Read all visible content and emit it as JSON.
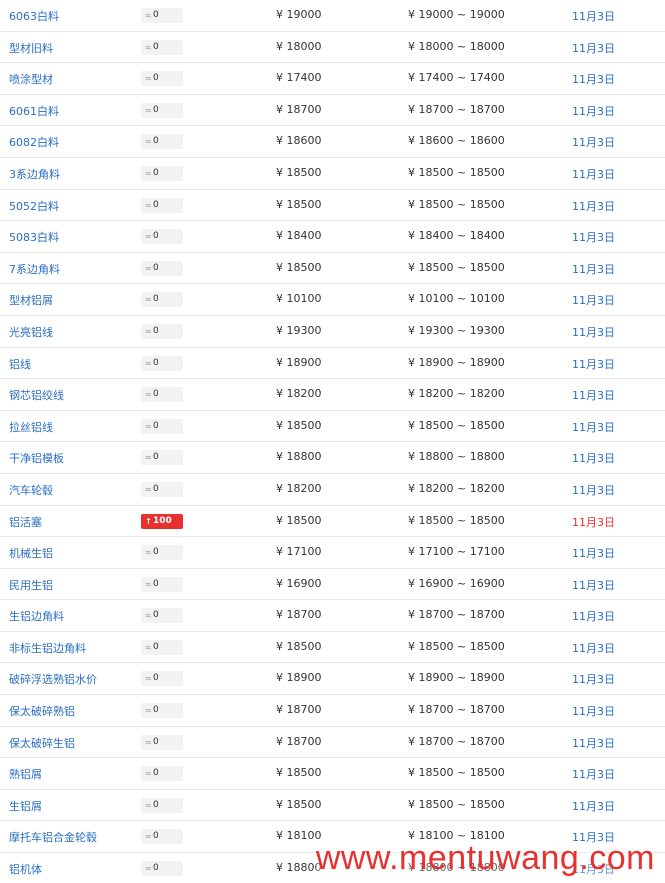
{
  "currency_symbol": "¥",
  "accent_color": "#2b6fc2",
  "up_color": "#e8302f",
  "watermark": "www.mentuwang.com",
  "rows": [
    {
      "name": "6063白料",
      "change": "0",
      "price": "¥ 19000",
      "range": "¥ 19000 ~ 19000",
      "date": "11月3日",
      "up": false
    },
    {
      "name": "型材旧料",
      "change": "0",
      "price": "¥ 18000",
      "range": "¥ 18000 ~ 18000",
      "date": "11月3日",
      "up": false
    },
    {
      "name": "喷涂型材",
      "change": "0",
      "price": "¥ 17400",
      "range": "¥ 17400 ~ 17400",
      "date": "11月3日",
      "up": false
    },
    {
      "name": "6061白料",
      "change": "0",
      "price": "¥ 18700",
      "range": "¥ 18700 ~ 18700",
      "date": "11月3日",
      "up": false
    },
    {
      "name": "6082白料",
      "change": "0",
      "price": "¥ 18600",
      "range": "¥ 18600 ~ 18600",
      "date": "11月3日",
      "up": false
    },
    {
      "name": "3系边角料",
      "change": "0",
      "price": "¥ 18500",
      "range": "¥ 18500 ~ 18500",
      "date": "11月3日",
      "up": false
    },
    {
      "name": "5052白料",
      "change": "0",
      "price": "¥ 18500",
      "range": "¥ 18500 ~ 18500",
      "date": "11月3日",
      "up": false
    },
    {
      "name": "5083白料",
      "change": "0",
      "price": "¥ 18400",
      "range": "¥ 18400 ~ 18400",
      "date": "11月3日",
      "up": false
    },
    {
      "name": "7系边角料",
      "change": "0",
      "price": "¥ 18500",
      "range": "¥ 18500 ~ 18500",
      "date": "11月3日",
      "up": false
    },
    {
      "name": "型材铝屑",
      "change": "0",
      "price": "¥ 10100",
      "range": "¥ 10100 ~ 10100",
      "date": "11月3日",
      "up": false
    },
    {
      "name": "光亮铝线",
      "change": "0",
      "price": "¥ 19300",
      "range": "¥ 19300 ~ 19300",
      "date": "11月3日",
      "up": false
    },
    {
      "name": "铝线",
      "change": "0",
      "price": "¥ 18900",
      "range": "¥ 18900 ~ 18900",
      "date": "11月3日",
      "up": false
    },
    {
      "name": "钢芯铝绞线",
      "change": "0",
      "price": "¥ 18200",
      "range": "¥ 18200 ~ 18200",
      "date": "11月3日",
      "up": false
    },
    {
      "name": "拉丝铝线",
      "change": "0",
      "price": "¥ 18500",
      "range": "¥ 18500 ~ 18500",
      "date": "11月3日",
      "up": false
    },
    {
      "name": "干净铝模板",
      "change": "0",
      "price": "¥ 18800",
      "range": "¥ 18800 ~ 18800",
      "date": "11月3日",
      "up": false
    },
    {
      "name": "汽车轮毂",
      "change": "0",
      "price": "¥ 18200",
      "range": "¥ 18200 ~ 18200",
      "date": "11月3日",
      "up": false
    },
    {
      "name": "铝活塞",
      "change": "100",
      "price": "¥ 18500",
      "range": "¥ 18500 ~ 18500",
      "date": "11月3日",
      "up": true
    },
    {
      "name": "机械生铝",
      "change": "0",
      "price": "¥ 17100",
      "range": "¥ 17100 ~ 17100",
      "date": "11月3日",
      "up": false
    },
    {
      "name": "民用生铝",
      "change": "0",
      "price": "¥ 16900",
      "range": "¥ 16900 ~ 16900",
      "date": "11月3日",
      "up": false
    },
    {
      "name": "生铝边角料",
      "change": "0",
      "price": "¥ 18700",
      "range": "¥ 18700 ~ 18700",
      "date": "11月3日",
      "up": false
    },
    {
      "name": "非标生铝边角料",
      "change": "0",
      "price": "¥ 18500",
      "range": "¥ 18500 ~ 18500",
      "date": "11月3日",
      "up": false
    },
    {
      "name": "破碎浮选熟铝水价",
      "change": "0",
      "price": "¥ 18900",
      "range": "¥ 18900 ~ 18900",
      "date": "11月3日",
      "up": false
    },
    {
      "name": "保太破碎熟铝",
      "change": "0",
      "price": "¥ 18700",
      "range": "¥ 18700 ~ 18700",
      "date": "11月3日",
      "up": false
    },
    {
      "name": "保太破碎生铝",
      "change": "0",
      "price": "¥ 18700",
      "range": "¥ 18700 ~ 18700",
      "date": "11月3日",
      "up": false
    },
    {
      "name": "熟铝屑",
      "change": "0",
      "price": "¥ 18500",
      "range": "¥ 18500 ~ 18500",
      "date": "11月3日",
      "up": false
    },
    {
      "name": "生铝屑",
      "change": "0",
      "price": "¥ 18500",
      "range": "¥ 18500 ~ 18500",
      "date": "11月3日",
      "up": false
    },
    {
      "name": "摩托车铝合金轮毂",
      "change": "0",
      "price": "¥ 18100",
      "range": "¥ 18100 ~ 18100",
      "date": "11月3日",
      "up": false
    },
    {
      "name": "铝机体",
      "change": "0",
      "price": "¥ 18800",
      "range": "¥ 18800 ~ 18800",
      "date": "11月3日",
      "up": false
    }
  ]
}
